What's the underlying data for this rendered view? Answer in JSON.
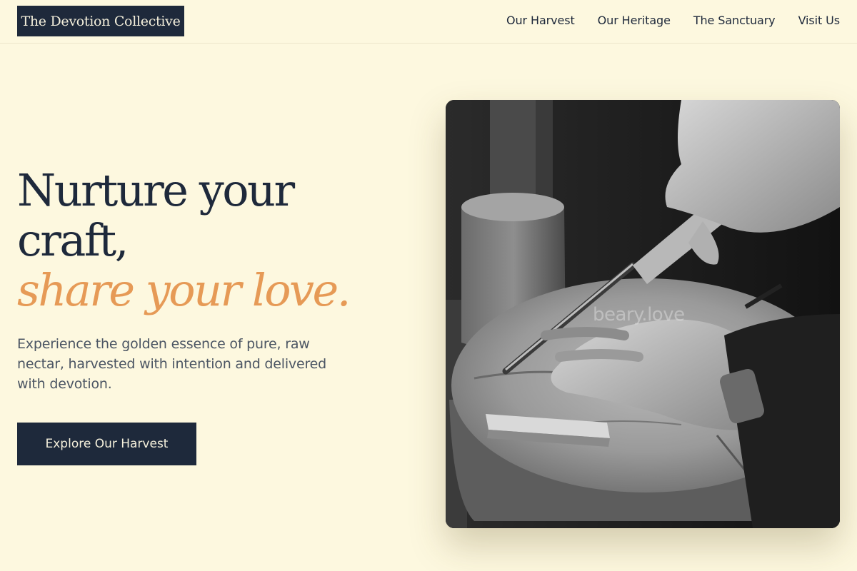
{
  "header": {
    "logo_text": "The Devotion Collective",
    "nav": [
      {
        "label": "Our Harvest"
      },
      {
        "label": "Our Heritage"
      },
      {
        "label": "The Sanctuary"
      },
      {
        "label": "Visit Us"
      }
    ]
  },
  "hero": {
    "headline_line1": "Nurture your",
    "headline_line2": "craft,",
    "headline_accent": "share your love.",
    "subtitle": "Experience the golden essence of pure, raw nectar, harvested with intention and delivered with devotion.",
    "cta_label": "Explore Our Harvest",
    "image": {
      "watermark": "beary.love",
      "subject": "black-and-white photo of hands carving wood with a chisel on a tree stump"
    }
  },
  "colors": {
    "background": "#fdf8df",
    "navy": "#1e293b",
    "accent": "#e69a56",
    "body_text": "#4b5563"
  }
}
